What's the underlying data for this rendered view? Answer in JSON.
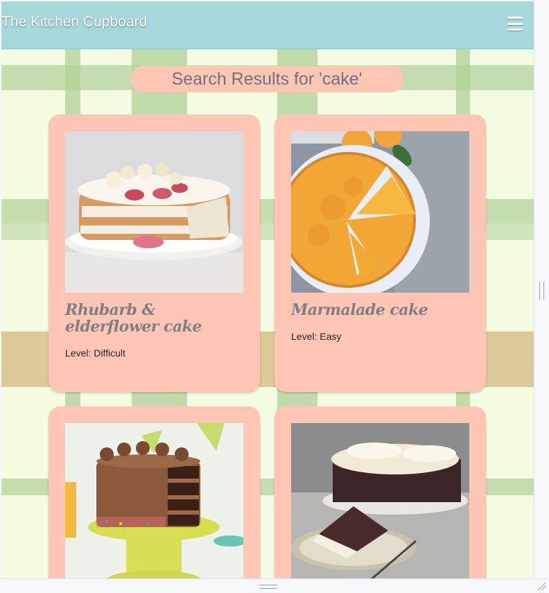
{
  "header": {
    "title": "The Kitchen Cupboard",
    "menu_icon": "hamburger-menu-icon"
  },
  "search": {
    "heading": "Search Results for 'cake'"
  },
  "results": [
    {
      "title": "Rhubarb & elderflower cake",
      "level": "Level: Difficult"
    },
    {
      "title": "Marmalade cake",
      "level": "Level: Easy"
    },
    {
      "title": "",
      "level": ""
    },
    {
      "title": "",
      "level": ""
    }
  ],
  "colors": {
    "header": "#a7d9dc",
    "card": "#ffc6b5",
    "heading_text": "#6b7286",
    "background": "#f4fde2"
  }
}
